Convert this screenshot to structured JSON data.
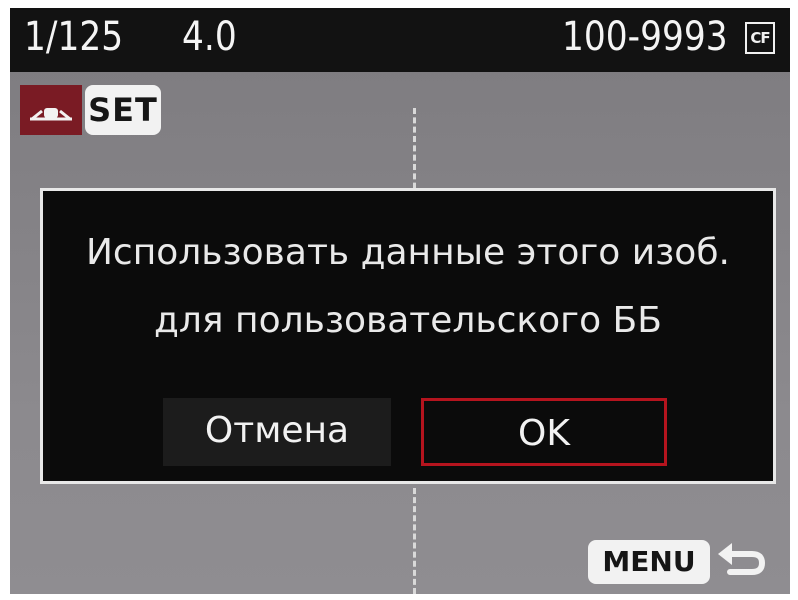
{
  "status_bar": {
    "shutter_speed": "1/125",
    "aperture": "4.0",
    "file_number": "100-9993",
    "card_icon": "cf-card-icon",
    "card_label": "CF"
  },
  "mode": {
    "wb_icon": "custom-white-balance-icon",
    "set_label": "SET"
  },
  "dialog": {
    "line1": "Использовать данные этого изоб.",
    "line2": "для пользовательского ББ",
    "cancel_label": "Отмена",
    "ok_label": "OK"
  },
  "footer": {
    "menu_label": "MENU",
    "back_icon": "return-arrow-icon"
  },
  "colors": {
    "dialog_background": "#0b0b0b",
    "selection_border": "#b5141e",
    "wb_icon_background": "#7a1b24"
  }
}
